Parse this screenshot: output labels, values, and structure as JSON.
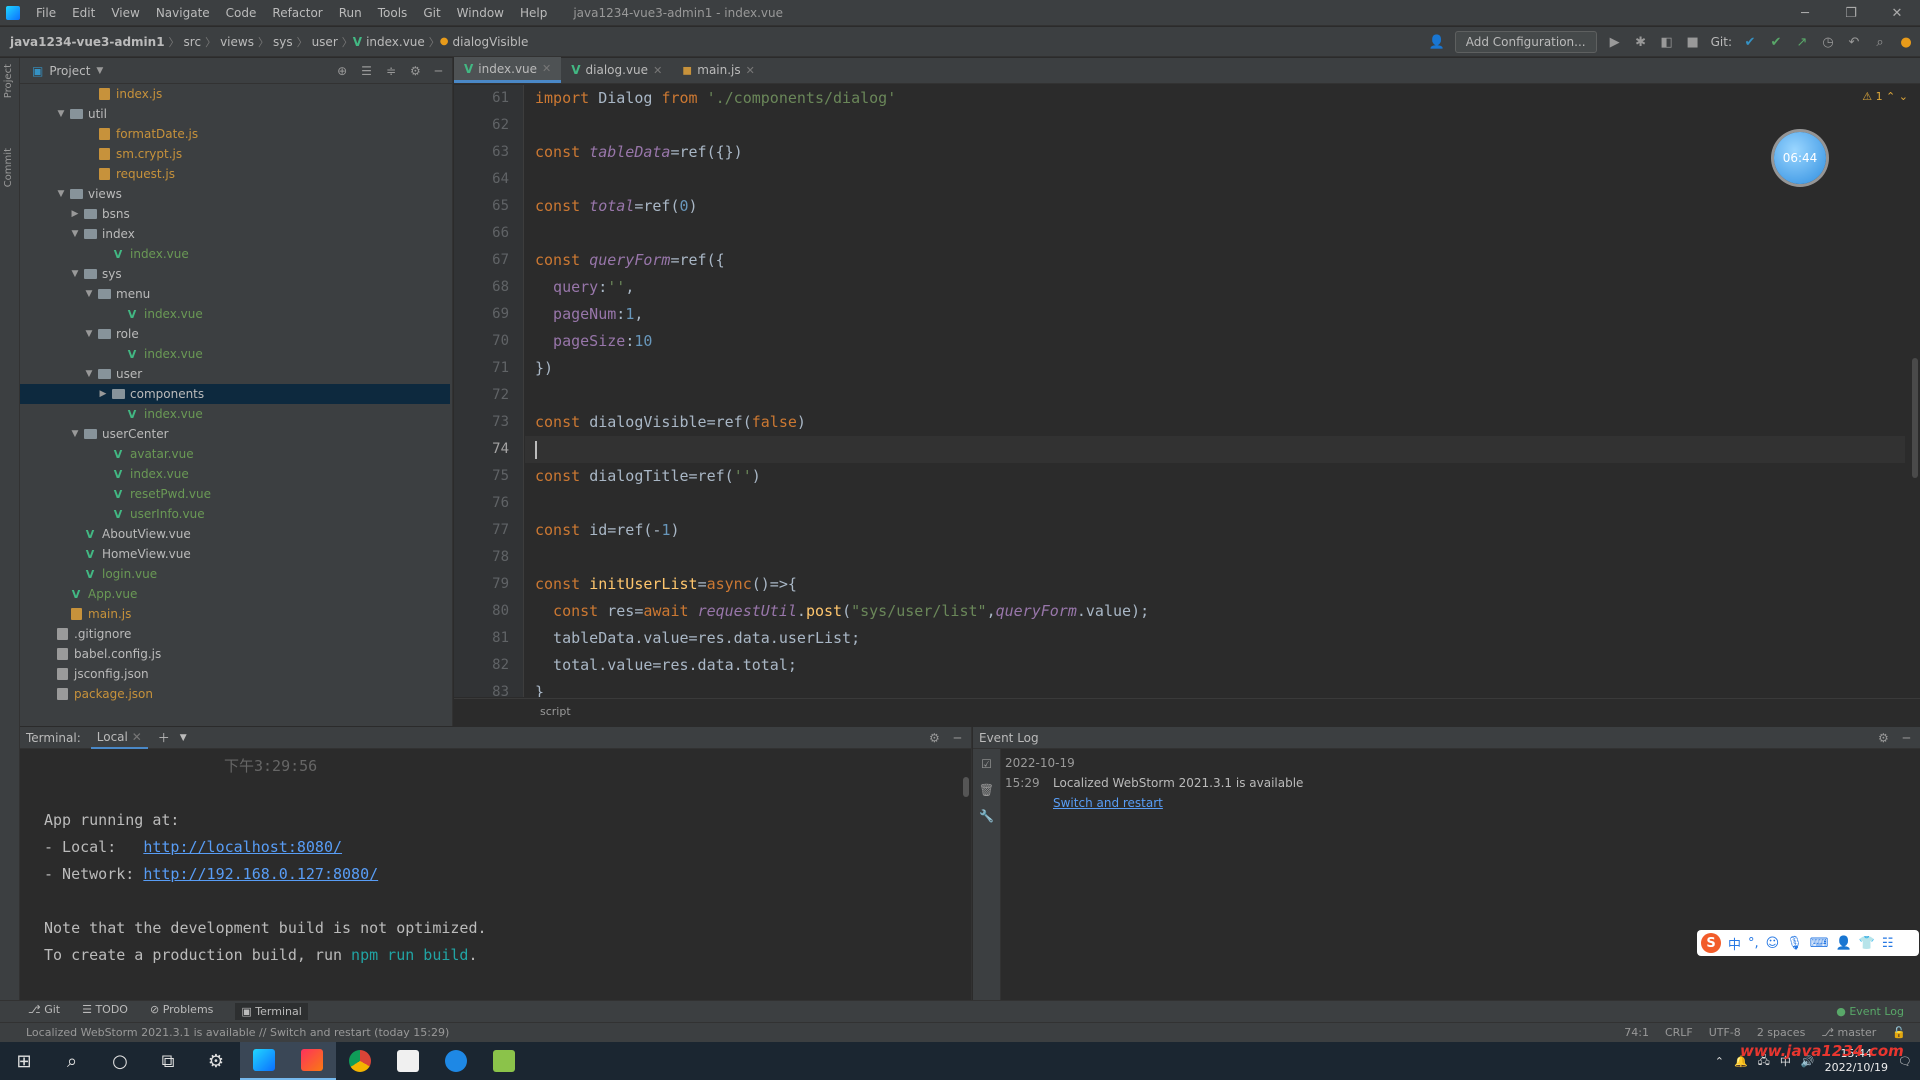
{
  "menubar": {
    "items": [
      "File",
      "Edit",
      "View",
      "Navigate",
      "Code",
      "Refactor",
      "Run",
      "Tools",
      "Git",
      "Window",
      "Help"
    ],
    "window_title": "java1234-vue3-admin1 - index.vue"
  },
  "navbar": {
    "crumbs": [
      "java1234-vue3-admin1",
      "src",
      "views",
      "sys",
      "user",
      "index.vue",
      "dialogVisible"
    ],
    "add_config": "Add Configuration...",
    "git_label": "Git:"
  },
  "project_panel": {
    "title": "Project",
    "tree": [
      {
        "depth": 5,
        "type": "js",
        "name": "index.js",
        "color": "orange"
      },
      {
        "depth": 3,
        "type": "folder",
        "name": "util",
        "open": true
      },
      {
        "depth": 5,
        "type": "js",
        "name": "formatDate.js",
        "color": "orange"
      },
      {
        "depth": 5,
        "type": "js",
        "name": "sm.crypt.js",
        "color": "orange"
      },
      {
        "depth": 5,
        "type": "js",
        "name": "request.js",
        "color": "orange"
      },
      {
        "depth": 3,
        "type": "folder",
        "name": "views",
        "open": true
      },
      {
        "depth": 4,
        "type": "folder",
        "name": "bsns",
        "open": false
      },
      {
        "depth": 4,
        "type": "folder",
        "name": "index",
        "open": true
      },
      {
        "depth": 6,
        "type": "vue",
        "name": "index.vue",
        "color": "green"
      },
      {
        "depth": 4,
        "type": "folder",
        "name": "sys",
        "open": true
      },
      {
        "depth": 5,
        "type": "folder",
        "name": "menu",
        "open": true
      },
      {
        "depth": 7,
        "type": "vue",
        "name": "index.vue",
        "color": "green"
      },
      {
        "depth": 5,
        "type": "folder",
        "name": "role",
        "open": true
      },
      {
        "depth": 7,
        "type": "vue",
        "name": "index.vue",
        "color": "green"
      },
      {
        "depth": 5,
        "type": "folder",
        "name": "user",
        "open": true
      },
      {
        "depth": 6,
        "type": "folder",
        "name": "components",
        "open": false,
        "selected": true
      },
      {
        "depth": 7,
        "type": "vue",
        "name": "index.vue",
        "color": "green"
      },
      {
        "depth": 4,
        "type": "folder",
        "name": "userCenter",
        "open": true
      },
      {
        "depth": 6,
        "type": "vue",
        "name": "avatar.vue",
        "color": "green"
      },
      {
        "depth": 6,
        "type": "vue",
        "name": "index.vue",
        "color": "green"
      },
      {
        "depth": 6,
        "type": "vue",
        "name": "resetPwd.vue",
        "color": "green"
      },
      {
        "depth": 6,
        "type": "vue",
        "name": "userInfo.vue",
        "color": "green"
      },
      {
        "depth": 4,
        "type": "vue",
        "name": "AboutView.vue",
        "color": "plain"
      },
      {
        "depth": 4,
        "type": "vue",
        "name": "HomeView.vue",
        "color": "plain"
      },
      {
        "depth": 4,
        "type": "vue",
        "name": "login.vue",
        "color": "green"
      },
      {
        "depth": 3,
        "type": "vue",
        "name": "App.vue",
        "color": "green"
      },
      {
        "depth": 3,
        "type": "js",
        "name": "main.js",
        "color": "orange"
      },
      {
        "depth": 2,
        "type": "cfg",
        "name": ".gitignore",
        "color": "plain"
      },
      {
        "depth": 2,
        "type": "cfg",
        "name": "babel.config.js",
        "color": "plain"
      },
      {
        "depth": 2,
        "type": "cfg",
        "name": "jsconfig.json",
        "color": "plain"
      },
      {
        "depth": 2,
        "type": "cfg",
        "name": "package.json",
        "color": "orange"
      }
    ]
  },
  "editor": {
    "tabs": [
      {
        "label": "index.vue",
        "icon": "V",
        "active": true
      },
      {
        "label": "dialog.vue",
        "icon": "V",
        "active": false
      },
      {
        "label": "main.js",
        "icon": "js",
        "active": false
      }
    ],
    "warning_count": "1",
    "avatar_time": "06:44",
    "crumb": "script",
    "current_line": 74,
    "lines": [
      {
        "n": 61,
        "t": [
          [
            "kw",
            "import "
          ],
          [
            "plain",
            "Dialog "
          ],
          [
            "kw",
            "from "
          ],
          [
            "str",
            "'./components/dialog'"
          ]
        ]
      },
      {
        "n": 62,
        "t": []
      },
      {
        "n": 63,
        "t": [
          [
            "kw",
            "const "
          ],
          [
            "var",
            "tableData"
          ],
          [
            "plain",
            "=ref({})"
          ]
        ]
      },
      {
        "n": 64,
        "t": []
      },
      {
        "n": 65,
        "t": [
          [
            "kw",
            "const "
          ],
          [
            "var",
            "total"
          ],
          [
            "plain",
            "=ref("
          ],
          [
            "num",
            "0"
          ],
          [
            "plain",
            ")"
          ]
        ]
      },
      {
        "n": 66,
        "t": []
      },
      {
        "n": 67,
        "t": [
          [
            "kw",
            "const "
          ],
          [
            "var",
            "queryForm"
          ],
          [
            "plain",
            "=ref({"
          ]
        ]
      },
      {
        "n": 68,
        "t": [
          [
            "prop",
            "  query"
          ],
          [
            "plain",
            ":"
          ],
          [
            "str",
            "''"
          ],
          [
            "plain",
            ","
          ]
        ]
      },
      {
        "n": 69,
        "t": [
          [
            "prop",
            "  pageNum"
          ],
          [
            "plain",
            ":"
          ],
          [
            "num",
            "1"
          ],
          [
            "plain",
            ","
          ]
        ]
      },
      {
        "n": 70,
        "t": [
          [
            "prop",
            "  pageSize"
          ],
          [
            "plain",
            ":"
          ],
          [
            "num",
            "10"
          ]
        ]
      },
      {
        "n": 71,
        "t": [
          [
            "plain",
            "})"
          ]
        ]
      },
      {
        "n": 72,
        "t": []
      },
      {
        "n": 73,
        "t": [
          [
            "kw",
            "const "
          ],
          [
            "plain",
            "dialogVisible=ref("
          ],
          [
            "kw",
            "false"
          ],
          [
            "plain",
            ")"
          ]
        ]
      },
      {
        "n": 74,
        "t": []
      },
      {
        "n": 75,
        "t": [
          [
            "kw",
            "const "
          ],
          [
            "plain",
            "dialogTitle=ref("
          ],
          [
            "str",
            "''"
          ],
          [
            "plain",
            ")"
          ]
        ]
      },
      {
        "n": 76,
        "t": []
      },
      {
        "n": 77,
        "t": [
          [
            "kw",
            "const "
          ],
          [
            "plain",
            "id=ref(-"
          ],
          [
            "num",
            "1"
          ],
          [
            "plain",
            ")"
          ]
        ]
      },
      {
        "n": 78,
        "t": []
      },
      {
        "n": 79,
        "t": [
          [
            "kw",
            "const "
          ],
          [
            "fn",
            "initUserList"
          ],
          [
            "plain",
            "="
          ],
          [
            "kw",
            "async"
          ],
          [
            "plain",
            "()=>{"
          ]
        ]
      },
      {
        "n": 80,
        "t": [
          [
            "kw",
            "  const "
          ],
          [
            "plain",
            "res="
          ],
          [
            "kw",
            "await "
          ],
          [
            "var",
            "requestUtil"
          ],
          [
            "plain",
            "."
          ],
          [
            "fn",
            "post"
          ],
          [
            "plain",
            "("
          ],
          [
            "str",
            "\"sys/user/list\""
          ],
          [
            "plain",
            ","
          ],
          [
            "var",
            "queryForm"
          ],
          [
            "plain",
            ".value);"
          ]
        ]
      },
      {
        "n": 81,
        "t": [
          [
            "plain",
            "  tableData.value=res.data.userList;"
          ]
        ]
      },
      {
        "n": 82,
        "t": [
          [
            "plain",
            "  total.value=res.data.total;"
          ]
        ]
      },
      {
        "n": 83,
        "t": [
          [
            "plain",
            "}"
          ]
        ]
      }
    ]
  },
  "terminal": {
    "title": "Terminal:",
    "tab": "Local",
    "timestamp": "下午3:29:56",
    "app_running": "App running at:",
    "local_label": "- Local:   ",
    "local_url": "http://localhost:8080/",
    "network_label": "- Network: ",
    "network_url": "http://192.168.0.127:8080/",
    "note": "Note that the development build is not optimized.",
    "prod_prefix": "To create a production build, run ",
    "prod_cmd": "npm run build",
    "prod_suffix": "."
  },
  "event_log": {
    "title": "Event Log",
    "date": "2022-10-19",
    "time": "15:29",
    "message": "Localized WebStorm 2021.3.1 is available",
    "link": "Switch and restart"
  },
  "bottom_tools": {
    "items": [
      "Git",
      "TODO",
      "Problems",
      "Terminal"
    ],
    "event_log": "Event Log"
  },
  "statusbar": {
    "message": "Localized WebStorm 2021.3.1 is available // Switch and restart (today 15:29)",
    "position": "74:1",
    "line_sep": "CRLF",
    "encoding": "UTF-8",
    "indent": "2 spaces",
    "branch": "master"
  },
  "taskbar": {
    "time": "15:44",
    "date": "2022/10/19",
    "watermark": "www.java1234.com"
  },
  "colors": {
    "accent": "#4a88c7",
    "keyword": "#cc7832",
    "string": "#6a8759",
    "number": "#6897bb",
    "link": "#589df6"
  }
}
